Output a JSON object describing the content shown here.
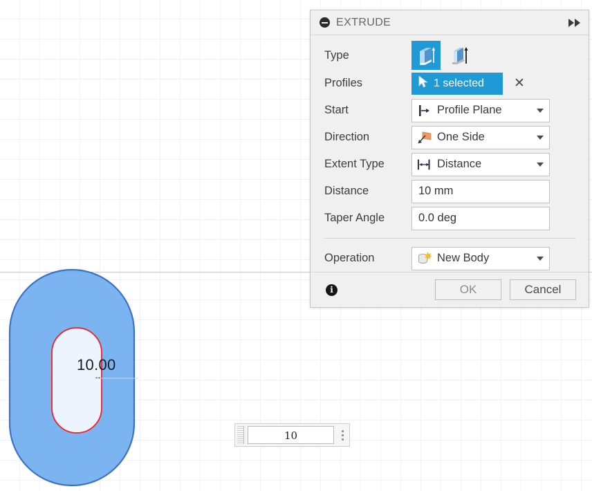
{
  "canvas": {
    "dimension_label": "10.00",
    "dimension_arrow_glyph": "↔",
    "axis_color": "#f3b7b7",
    "profile_fill": "#6aa9ef",
    "profile_stroke": "#3b72c4",
    "inner_fill": "#edf4fd",
    "inner_stroke": "#ee2222"
  },
  "manipulator": {
    "value": "10",
    "grip_icon": "drag-grip-icon",
    "dots_icon": "more-handle-icon"
  },
  "dialog": {
    "title": "EXTRUDE",
    "collapse_icon": "collapse-icon",
    "expand_icon": "expand-arrows-icon",
    "accent_color": "#1f9ad6",
    "rows": [
      {
        "label": "Type",
        "kind": "icon-toggle",
        "options": [
          {
            "icon": "extrude-type-solid-icon",
            "selected": true
          },
          {
            "icon": "extrude-type-thin-icon",
            "selected": false
          }
        ]
      },
      {
        "label": "Profiles",
        "kind": "selection",
        "chip_icon": "cursor-arrow-icon",
        "chip_label": "1 selected",
        "clear_label": "✕"
      },
      {
        "label": "Start",
        "kind": "combo",
        "icon": "profile-plane-icon",
        "value": "Profile Plane"
      },
      {
        "label": "Direction",
        "kind": "combo",
        "icon": "one-side-direction-icon",
        "value": "One Side"
      },
      {
        "label": "Extent Type",
        "kind": "combo",
        "icon": "distance-extent-icon",
        "value": "Distance"
      },
      {
        "label": "Distance",
        "kind": "text",
        "value": "10 mm"
      },
      {
        "label": "Taper Angle",
        "kind": "text",
        "value": "0.0 deg"
      },
      {
        "label": "Operation",
        "kind": "combo",
        "icon": "new-body-icon",
        "value": "New Body"
      }
    ],
    "footer": {
      "info_icon": "info-icon",
      "info_glyph": "i",
      "ok_label": "OK",
      "cancel_label": "Cancel"
    }
  }
}
